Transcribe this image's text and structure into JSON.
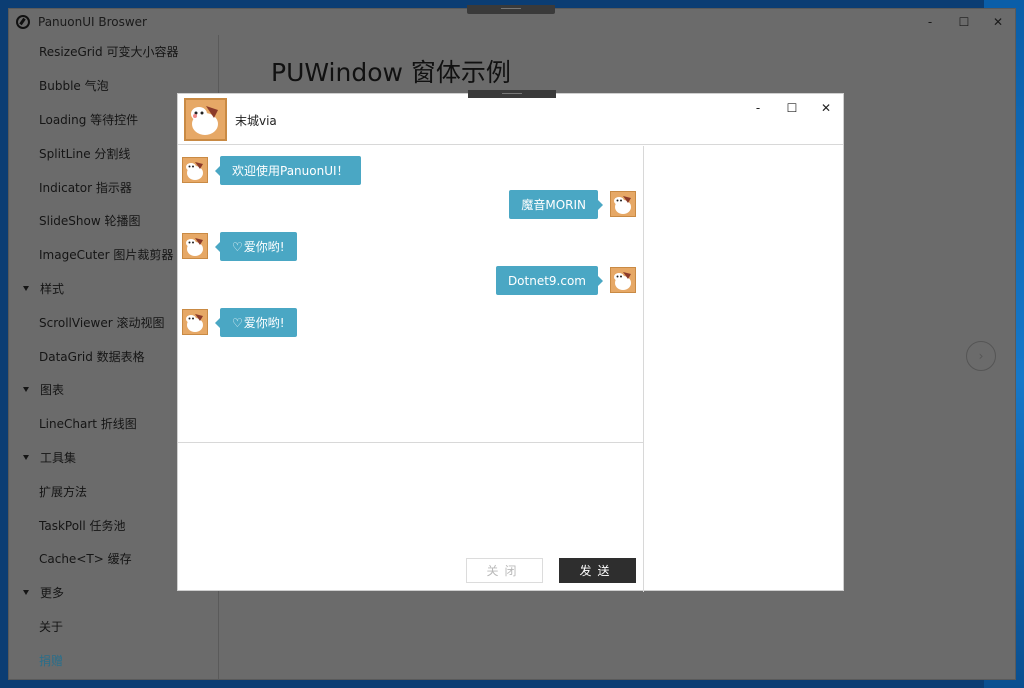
{
  "app": {
    "title": "PanuonUI Broswer",
    "min_label": "-",
    "max_label": "☐",
    "close_label": "✕"
  },
  "sidebar": {
    "items": [
      {
        "label": "ResizeGrid 可变大小容器",
        "kind": "item"
      },
      {
        "label": "Bubble 气泡",
        "kind": "item"
      },
      {
        "label": "Loading 等待控件",
        "kind": "item"
      },
      {
        "label": "SplitLine 分割线",
        "kind": "item"
      },
      {
        "label": "Indicator 指示器",
        "kind": "item"
      },
      {
        "label": "SlideShow 轮播图",
        "kind": "item"
      },
      {
        "label": "ImageCuter 图片裁剪器",
        "kind": "item"
      },
      {
        "label": "样式",
        "kind": "group"
      },
      {
        "label": "ScrollViewer 滚动视图",
        "kind": "item"
      },
      {
        "label": "DataGrid 数据表格",
        "kind": "item"
      },
      {
        "label": "图表",
        "kind": "group"
      },
      {
        "label": "LineChart 折线图",
        "kind": "item"
      },
      {
        "label": "工具集",
        "kind": "group"
      },
      {
        "label": "扩展方法",
        "kind": "item"
      },
      {
        "label": "TaskPoll 任务池",
        "kind": "item"
      },
      {
        "label": "Cache<T> 缓存",
        "kind": "item"
      },
      {
        "label": "更多",
        "kind": "group"
      },
      {
        "label": "关于",
        "kind": "item"
      },
      {
        "label": "捐赠",
        "kind": "item",
        "active": true
      }
    ]
  },
  "main": {
    "page_title": "PUWindow 窗体示例",
    "next_icon": "›"
  },
  "chat": {
    "contact_name": "末城via",
    "min_label": "-",
    "max_label": "☐",
    "close_label": "✕",
    "messages": [
      {
        "side": "left",
        "text": "欢迎使用PanuonUI！",
        "heart": false
      },
      {
        "side": "right",
        "text": "魔音MORIN",
        "heart": false
      },
      {
        "side": "left",
        "text": "爱你哟!",
        "heart": true
      },
      {
        "side": "right",
        "text": "Dotnet9.com",
        "heart": false
      },
      {
        "side": "left",
        "text": "爱你哟!",
        "heart": true
      }
    ],
    "heart_glyph": "♡",
    "close_button": "关闭",
    "send_button": "发送"
  },
  "colors": {
    "bubble": "#4aa7c4",
    "send_button": "#2e2e2e",
    "overlay": "#6b6b6b"
  }
}
